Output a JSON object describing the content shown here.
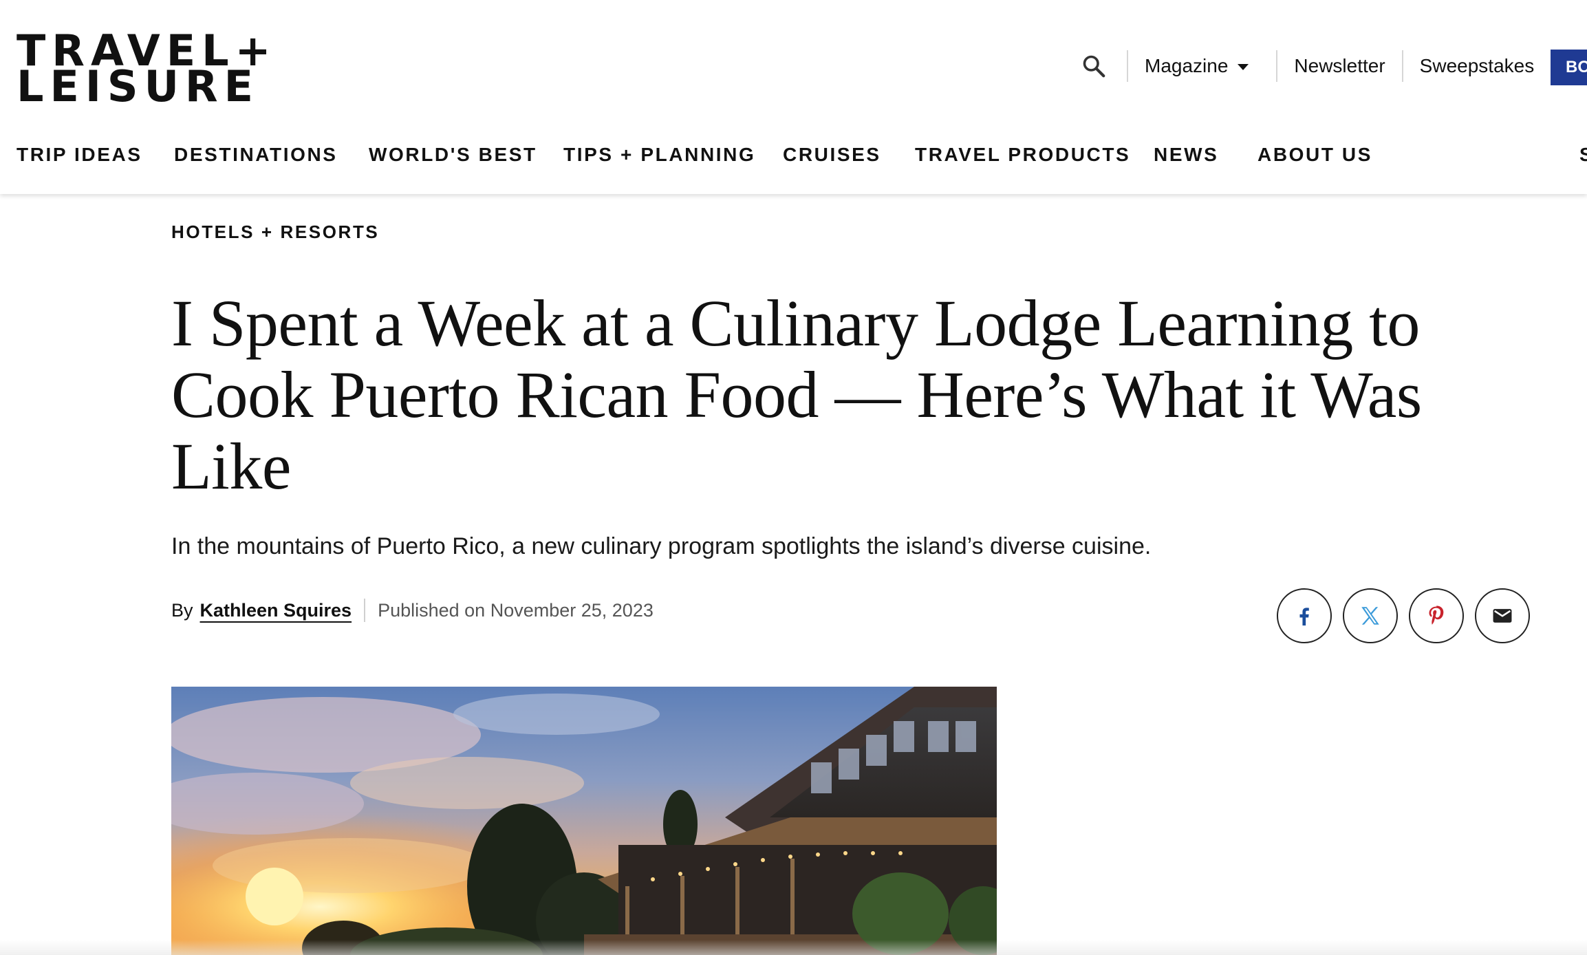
{
  "brand": {
    "logo_line1": "TRAVEL+",
    "logo_line2": "LEISURE"
  },
  "utility_nav": {
    "search_icon": "search-icon",
    "magazine_label": "Magazine",
    "newsletter_label": "Newsletter",
    "sweepstakes_label": "Sweepstakes",
    "cta_label": "BO",
    "cta_color": "#1f3a93"
  },
  "main_nav": {
    "items": [
      {
        "label": "TRIP IDEAS"
      },
      {
        "label": "DESTINATIONS"
      },
      {
        "label": "WORLD'S BEST"
      },
      {
        "label": "TIPS + PLANNING"
      },
      {
        "label": "CRUISES"
      },
      {
        "label": "TRAVEL PRODUCTS"
      },
      {
        "label": "NEWS"
      },
      {
        "label": "ABOUT US"
      },
      {
        "label": "S"
      }
    ]
  },
  "article": {
    "category": "HOTELS + RESORTS",
    "headline": "I Spent a Week at a Culinary Lodge Learning to Cook Puerto Rican Food — Here’s What it Was Like",
    "dek": "In the mountains of Puerto Rico, a new culinary program spotlights the island’s diverse cuisine.",
    "byline_prefix": "By",
    "author": "Kathleen Squires",
    "published": "Published on November 25, 2023"
  },
  "share": {
    "facebook_color": "#1b4e9c",
    "x_color": "#3a9ad9",
    "pinterest_color": "#c8232c",
    "email_color": "#222222",
    "icons": [
      "facebook-icon",
      "x-icon",
      "pinterest-icon",
      "email-icon"
    ]
  }
}
